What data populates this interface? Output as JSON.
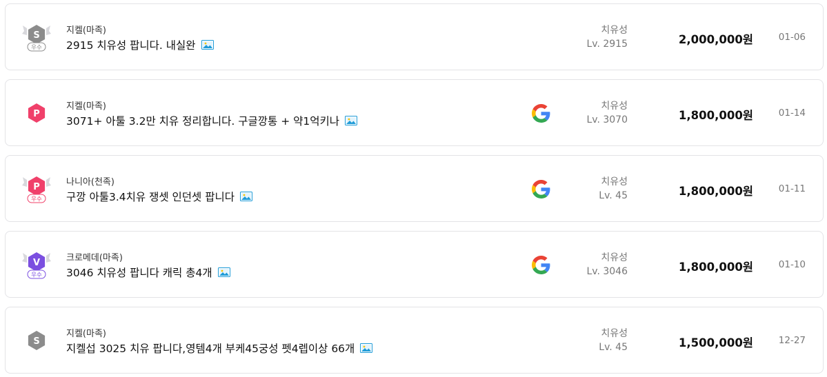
{
  "listings": [
    {
      "server": "지켈(마족)",
      "title": "2915 치유성 팝니다. 내실완",
      "badge": {
        "letter": "S",
        "rank": "우수",
        "color": "#8c8c8c",
        "icon": "server-s-excellent-icon"
      },
      "google": false,
      "job": "치유성",
      "level": "Lv. 2915",
      "price": "2,000,000원",
      "date": "01-06"
    },
    {
      "server": "지켈(마족)",
      "title": "3071+ 아툴 3.2만 치유 정리합니다. 구글깡통 + 약1억키나",
      "badge": {
        "letter": "P",
        "rank": "",
        "color": "#f0406a",
        "icon": "power-p-icon"
      },
      "google": true,
      "job": "치유성",
      "level": "Lv. 3070",
      "price": "1,800,000원",
      "date": "01-14"
    },
    {
      "server": "나니아(천족)",
      "title": "구깡 아툴3.4치유 쟁셋 인던셋 팝니다",
      "badge": {
        "letter": "P",
        "rank": "우수",
        "color": "#f0406a",
        "icon": "power-p-excellent-icon"
      },
      "google": true,
      "job": "치유성",
      "level": "Lv. 45",
      "price": "1,800,000원",
      "date": "01-11"
    },
    {
      "server": "크로메데(마족)",
      "title": "3046 치유성 팝니다 캐릭 총4개",
      "badge": {
        "letter": "V",
        "rank": "우수",
        "color": "#7b4fe0",
        "icon": "vip-v-excellent-icon"
      },
      "google": true,
      "job": "치유성",
      "level": "Lv. 3046",
      "price": "1,800,000원",
      "date": "01-10"
    },
    {
      "server": "지켈(마족)",
      "title": "지켈섭 3025 치유 팝니다,영템4개 부케45궁성 펫4렙이상 66개",
      "badge": {
        "letter": "S",
        "rank": "",
        "color": "#8c8c8c",
        "icon": "server-s-icon"
      },
      "google": false,
      "job": "치유성",
      "level": "Lv. 45",
      "price": "1,500,000원",
      "date": "12-27"
    }
  ]
}
